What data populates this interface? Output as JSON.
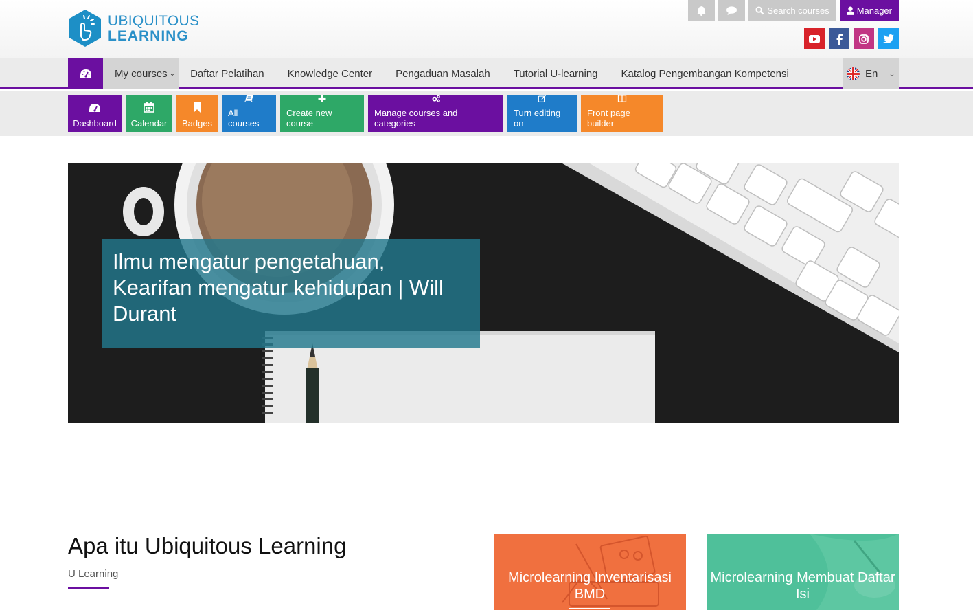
{
  "brand": {
    "line1": "UBIQUITOUS",
    "line2": "LEARNING"
  },
  "top_actions": {
    "notifications_icon": "bell-icon",
    "messages_icon": "chat-bubble-icon",
    "search_label": "Search courses",
    "user_label": "Manager"
  },
  "social": [
    "youtube-icon",
    "facebook-icon",
    "instagram-icon",
    "twitter-icon"
  ],
  "colors": {
    "accent": "#6b0fa0",
    "green": "#2ea867",
    "orange": "#f5882a",
    "blue": "#1f7cc9",
    "youtube": "#d8232a",
    "facebook": "#3b5998",
    "instagram": "#c13584",
    "twitter": "#1da1f2"
  },
  "nav": {
    "items": [
      {
        "label": "My courses"
      },
      {
        "label": "Daftar Pelatihan"
      },
      {
        "label": "Knowledge Center"
      },
      {
        "label": "Pengaduan Masalah"
      },
      {
        "label": "Tutorial U-learning"
      },
      {
        "label": "Katalog Pengembangan Kompetensi"
      }
    ],
    "language": "En"
  },
  "quick_links": [
    {
      "label": "Dashboard",
      "icon": "dashboard-icon"
    },
    {
      "label": "Calendar",
      "icon": "calendar-icon"
    },
    {
      "label": "Badges",
      "icon": "bookmark-icon"
    },
    {
      "label": "All courses",
      "icon": "book-icon"
    },
    {
      "label": "Create new course",
      "icon": "plus-icon"
    },
    {
      "label": "Manage courses and categories",
      "icon": "cogs-icon"
    },
    {
      "label": "Turn editing on",
      "icon": "edit-icon"
    },
    {
      "label": "Front page builder",
      "icon": "columns-icon"
    }
  ],
  "hero": {
    "caption": "Ilmu mengatur pengetahuan, Kearifan mengatur kehidupan | Will Durant"
  },
  "about": {
    "title": "Apa itu Ubiquitous Learning",
    "subtitle": "U Learning"
  },
  "cards": [
    {
      "title": "Microlearning Inventarisasi BMD"
    },
    {
      "title": "Microlearning Membuat Daftar Isi"
    }
  ]
}
